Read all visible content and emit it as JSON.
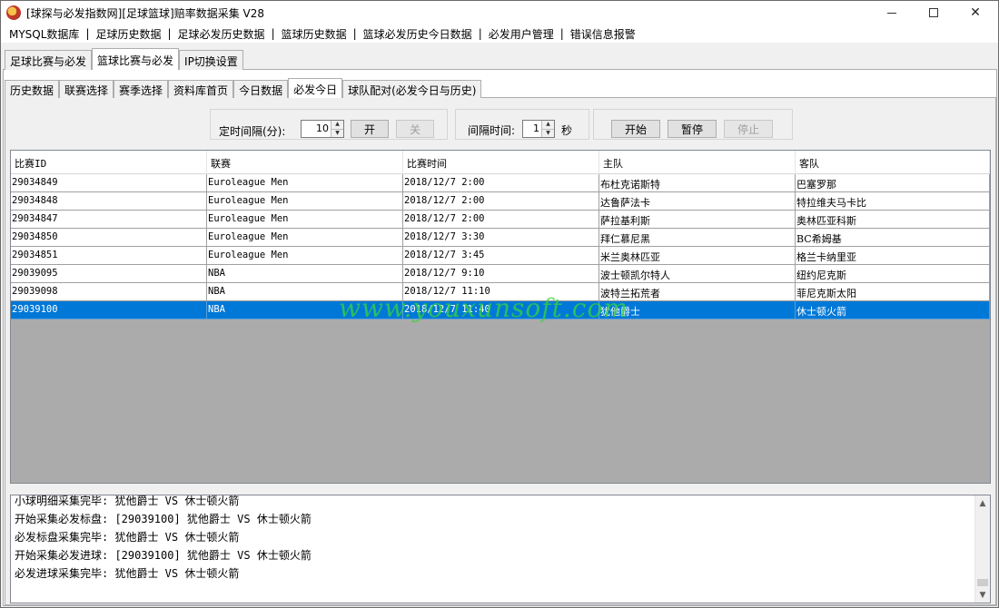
{
  "window": {
    "title": "[球探与必发指数网][足球篮球]赔率数据采集 V28",
    "icon": "app-logo-icon"
  },
  "menu": {
    "items": [
      "MYSQL数据库",
      "足球历史数据",
      "足球必发历史数据",
      "篮球历史数据",
      "篮球必发历史今日数据",
      "必发用户管理",
      "错误信息报警"
    ],
    "separator": "|"
  },
  "top_tabs": [
    "足球比赛与必发",
    "篮球比赛与必发",
    "IP切换设置"
  ],
  "top_tab_active": 1,
  "sub_tabs": [
    "历史数据",
    "联赛选择",
    "赛季选择",
    "资料库首页",
    "今日数据",
    "必发今日",
    "球队配对(必发今日与历史)"
  ],
  "sub_tab_active": 5,
  "controls": {
    "interval_label": "定时间隔(分):",
    "interval_value": "10",
    "start_timer_label": "开",
    "stop_timer_label": "关",
    "gap_label": "间隔时间:",
    "gap_value": "1",
    "gap_unit": "秒",
    "start_label": "开始",
    "pause_label": "暂停",
    "stop_label": "停止"
  },
  "table": {
    "columns": [
      "比赛ID",
      "联赛",
      "比赛时间",
      "主队",
      "客队"
    ],
    "rows": [
      [
        "29034849",
        "Euroleague Men",
        "2018/12/7 2:00",
        "布杜克诺斯特",
        "巴塞罗那"
      ],
      [
        "29034848",
        "Euroleague Men",
        "2018/12/7 2:00",
        "达鲁萨法卡",
        "特拉维夫马卡比"
      ],
      [
        "29034847",
        "Euroleague Men",
        "2018/12/7 2:00",
        "萨拉基利斯",
        "奥林匹亚科斯"
      ],
      [
        "29034850",
        "Euroleague Men",
        "2018/12/7 3:30",
        "拜仁慕尼黑",
        "BC希姆基"
      ],
      [
        "29034851",
        "Euroleague Men",
        "2018/12/7 3:45",
        "米兰奥林匹亚",
        "格兰卡纳里亚"
      ],
      [
        "29039095",
        "NBA",
        "2018/12/7 9:10",
        "波士顿凯尔特人",
        "纽约尼克斯"
      ],
      [
        "29039098",
        "NBA",
        "2018/12/7 11:10",
        "波特兰拓荒者",
        "菲尼克斯太阳"
      ],
      [
        "29039100",
        "NBA",
        "2018/12/7 11:40",
        "犹他爵士",
        "休士顿火箭"
      ]
    ],
    "selected_row": 7
  },
  "watermark": "www.youxunsoft.com",
  "log": [
    "小球明细采集完毕: 犹他爵士 VS 休士顿火箭",
    "开始采集必发标盘: [29039100] 犹他爵士 VS 休士顿火箭",
    "必发标盘采集完毕: 犹他爵士 VS 休士顿火箭",
    "开始采集必发进球: [29039100] 犹他爵士 VS 休士顿火箭",
    "必发进球采集完毕: 犹他爵士 VS 休士顿火箭"
  ],
  "colors": {
    "selection": "#0078d7",
    "watermark": "#3ad43a",
    "window_bg": "#f0f0f0"
  }
}
